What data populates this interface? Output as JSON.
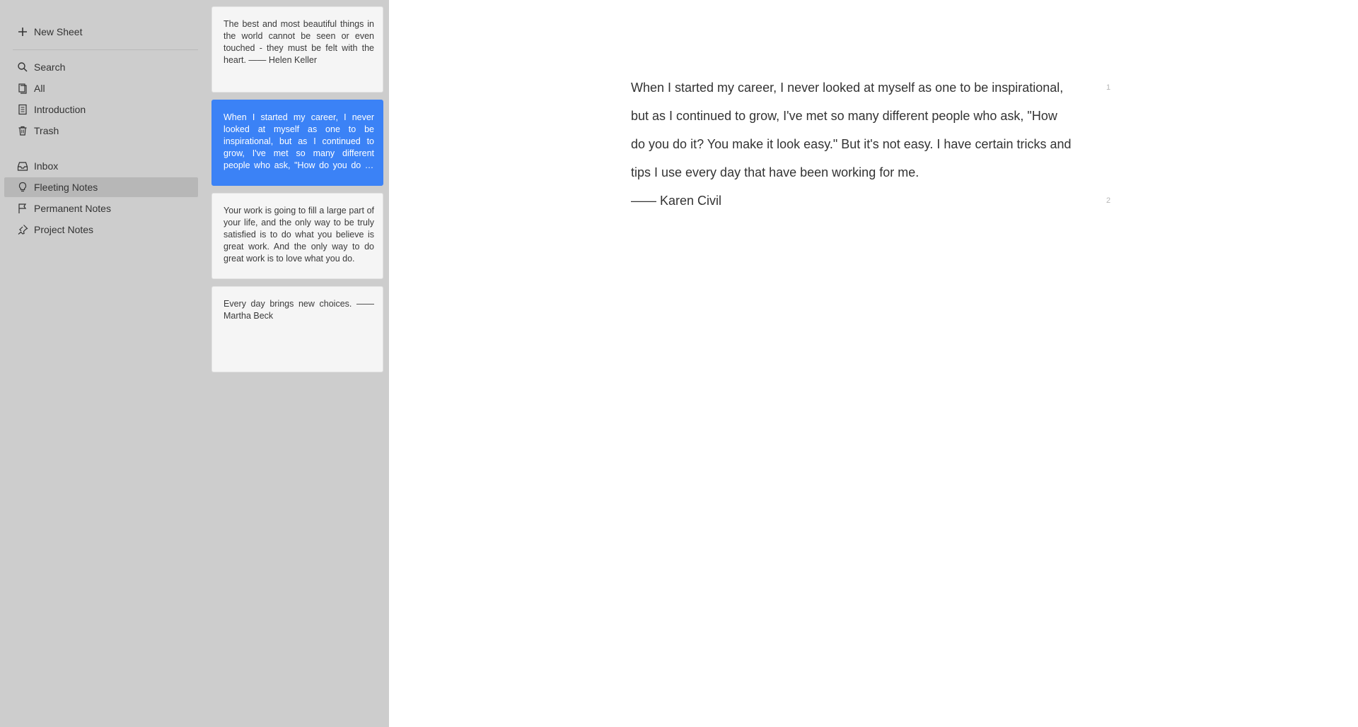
{
  "sidebar": {
    "new_sheet": "New Sheet",
    "items": [
      {
        "label": "Search",
        "icon": "search-icon"
      },
      {
        "label": "All",
        "icon": "library-icon"
      },
      {
        "label": "Introduction",
        "icon": "document-icon"
      },
      {
        "label": "Trash",
        "icon": "trash-icon"
      },
      {
        "label": "Inbox",
        "icon": "inbox-icon"
      },
      {
        "label": "Fleeting Notes",
        "icon": "lightbulb-icon"
      },
      {
        "label": "Permanent Notes",
        "icon": "flag-icon"
      },
      {
        "label": "Project Notes",
        "icon": "pin-icon"
      }
    ],
    "active": "Fleeting Notes"
  },
  "notes": [
    {
      "preview": "The best and most beautiful things in the world cannot be seen or even touched - they must be felt with the heart. —— Helen Keller"
    },
    {
      "preview": "When I started my career, I never looked at myself as one to be inspirational, but as I continued to grow, I've met so many different people who ask, \"How do you do it? You make it look easy.\" But it's not easy.",
      "selected": true
    },
    {
      "preview": "Your work is going to fill a large part of your life, and the only way to be truly satisfied is to do what you believe is great work. And the only way to do great work is to love what you do."
    },
    {
      "preview": "Every day brings new choices. —— Martha Beck"
    }
  ],
  "editor": {
    "paragraphs": [
      {
        "text": "When I started my career, I never looked at myself as one to be inspirational, but as I continued to grow, I've met so many different people who ask, \"How do you do it? You make it look easy.\" But it's not easy. I have certain tricks and tips I use every day that have been working for me.",
        "line": "1"
      },
      {
        "text": "—— Karen Civil",
        "line": "2"
      }
    ]
  },
  "colors": {
    "sidebar_bg": "#cdcdcd",
    "active_item_bg": "#b7b7b7",
    "selected_card_bg": "#3b82f6",
    "card_bg": "#f5f5f5"
  }
}
